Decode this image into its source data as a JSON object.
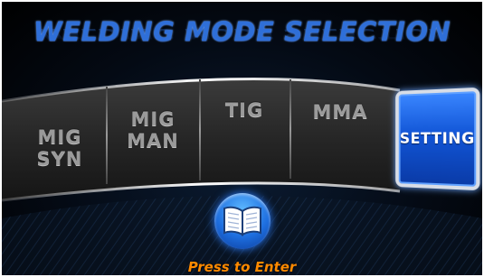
{
  "title": "WELDING MODE SELECTION",
  "modes": [
    {
      "label": "MIG\nSYN",
      "selected": false
    },
    {
      "label": "MIG\nMAN",
      "selected": false
    },
    {
      "label": "TIG",
      "selected": false
    },
    {
      "label": "MMA",
      "selected": false
    },
    {
      "label": "SETTING",
      "selected": true
    }
  ],
  "enter": {
    "label": "Press to Enter",
    "icon": "book-icon"
  },
  "colors": {
    "title": "#2f6fd8",
    "selected_bg": "#1155d6",
    "enter_text": "#ff8a00",
    "mode_text": "#9a9a9a"
  }
}
